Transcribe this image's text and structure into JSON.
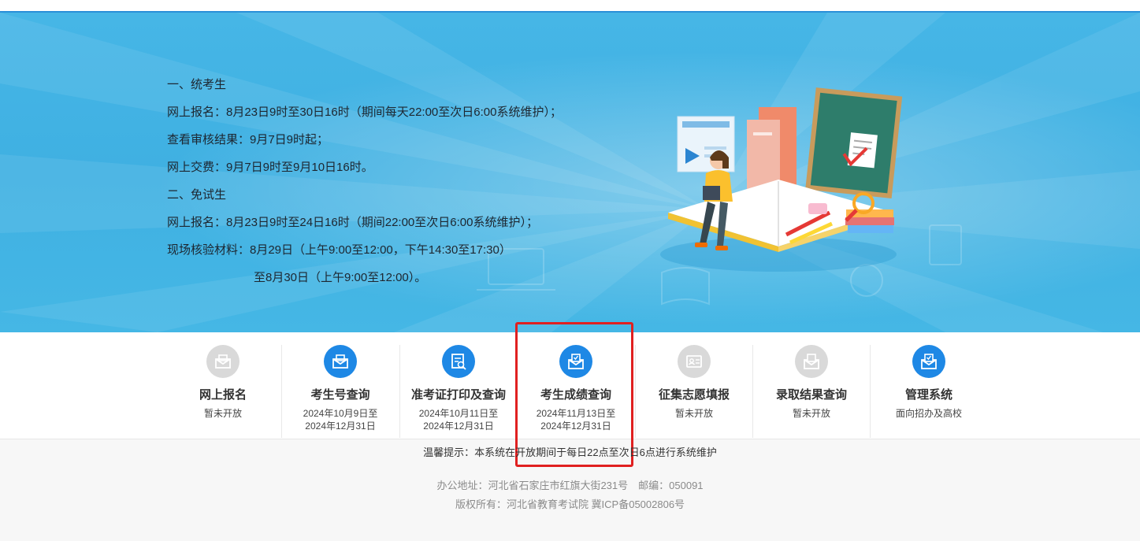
{
  "notice": {
    "lines": [
      "一、统考生",
      "网上报名：8月23日9时至30日16时（期间每天22:00至次日6:00系统维护）；",
      "查看审核结果：9月7日9时起；",
      "网上交费：9月7日9时至9月10日16时。",
      "二、免试生",
      "网上报名：8月23日9时至24日16时（期间22:00至次日6:00系统维护）；",
      "现场核验材料：8月29日（上午9:00至12:00，下午14:30至17:30）",
      "至8月30日（上午9:00至12:00）。"
    ]
  },
  "services": [
    {
      "title": "网上报名",
      "sub1": "暂未开放",
      "sub2": "",
      "status": "disabled",
      "icon": "mail-icon"
    },
    {
      "title": "考生号查询",
      "sub1": "2024年10月9日至",
      "sub2": "2024年12月31日",
      "status": "active",
      "icon": "mail-icon"
    },
    {
      "title": "准考证打印及查询",
      "sub1": "2024年10月11日至",
      "sub2": "2024年12月31日",
      "status": "active",
      "icon": "document-search-icon"
    },
    {
      "title": "考生成绩查询",
      "sub1": "2024年11月13日至",
      "sub2": "2024年12月31日",
      "status": "active",
      "icon": "score-envelope-icon"
    },
    {
      "title": "征集志愿填报",
      "sub1": "暂未开放",
      "sub2": "",
      "status": "disabled",
      "icon": "id-card-icon"
    },
    {
      "title": "录取结果查询",
      "sub1": "暂未开放",
      "sub2": "",
      "status": "disabled",
      "icon": "envelope-icon"
    },
    {
      "title": "管理系统",
      "sub1": "面向招办及高校",
      "sub2": "",
      "status": "active",
      "icon": "envelope-icon"
    }
  ],
  "tip": "温馨提示：本系统在开放期间于每日22点至次日6点进行系统维护",
  "footer": {
    "address": "办公地址：河北省石家庄市红旗大街231号　邮编：050091",
    "copyright": "版权所有：河北省教育考试院 冀ICP备05002806号"
  },
  "colors": {
    "accent": "#1e88e5",
    "banner": "#3fb0e2",
    "highlight": "#e02020"
  }
}
